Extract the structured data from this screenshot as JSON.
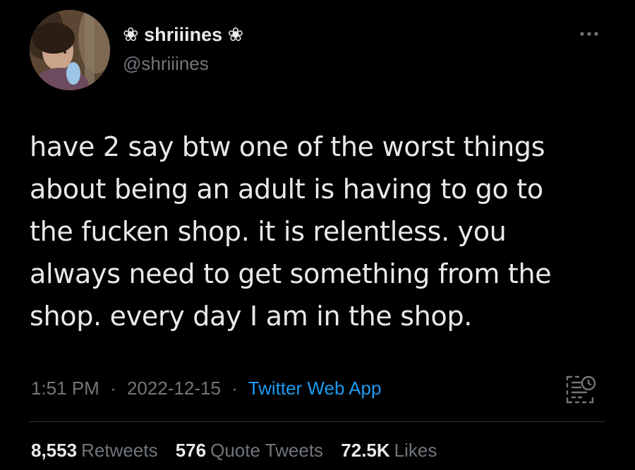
{
  "author": {
    "display_name": "❀ shriiines ❀",
    "handle": "@shriiines"
  },
  "tweet": {
    "text_lines": [
      "have 2 say btw one of the worst things",
      "about being an adult is having to go to",
      "the fucken shop. it is relentless. you",
      "always need to get something from the",
      "shop. every day I am in the shop."
    ]
  },
  "meta": {
    "time": "1:51 PM",
    "date": "2022-12-15",
    "separator": "·",
    "source": "Twitter Web App"
  },
  "stats": {
    "retweets_count": "8,553",
    "retweets_label": "Retweets",
    "quotes_count": "576",
    "quotes_label": "Quote Tweets",
    "likes_count": "72.5K",
    "likes_label": "Likes"
  },
  "icons": {
    "more": "more-horizontal-icon",
    "analytics": "analytics-icon"
  },
  "colors": {
    "background": "#000000",
    "text": "#e7e9ea",
    "secondary_text": "#71767b",
    "link": "#1d9bf0",
    "divider": "#2f3336"
  }
}
